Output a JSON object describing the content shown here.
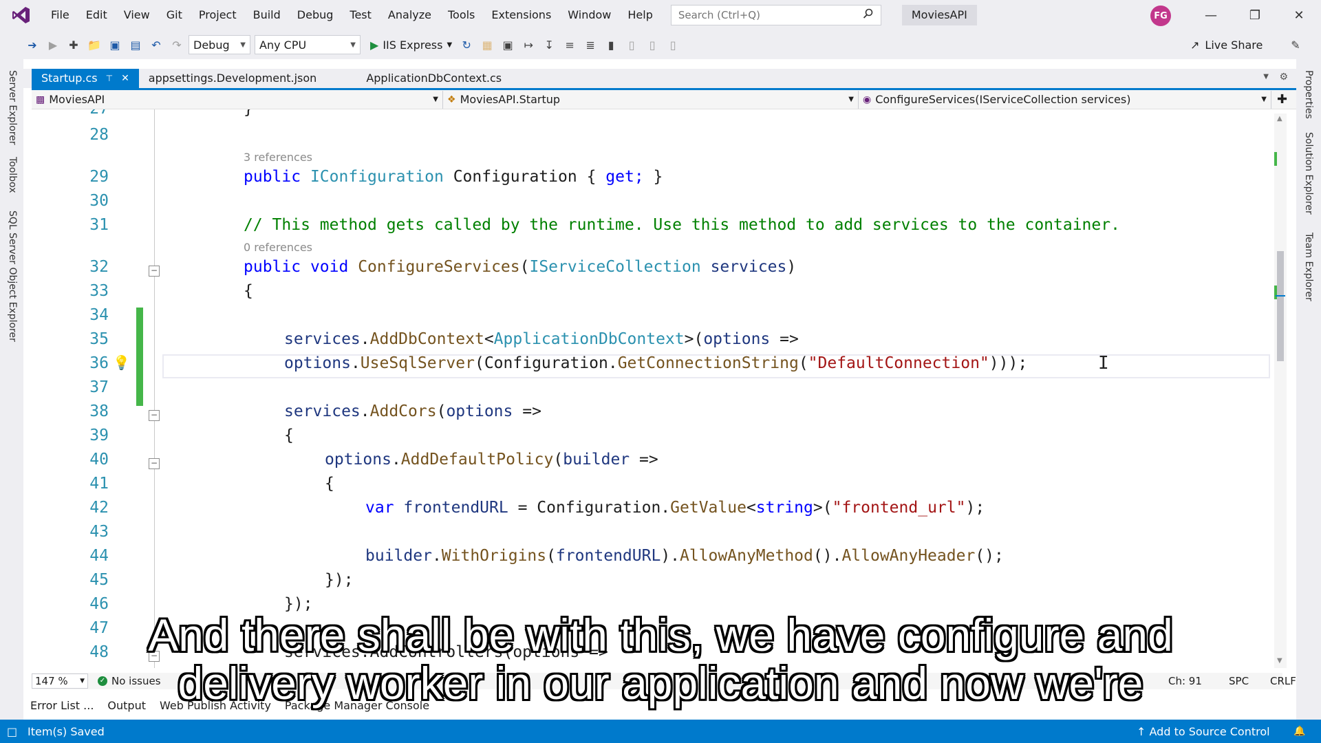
{
  "menubar": {
    "items": [
      "File",
      "Edit",
      "View",
      "Git",
      "Project",
      "Build",
      "Debug",
      "Test",
      "Analyze",
      "Tools",
      "Extensions",
      "Window",
      "Help"
    ],
    "search_placeholder": "Search (Ctrl+Q)",
    "solution_name": "MoviesAPI",
    "avatar_initials": "FG"
  },
  "toolbar": {
    "configuration": "Debug",
    "platform": "Any CPU",
    "run_target": "IIS Express",
    "live_share": "Live Share"
  },
  "left_rail": [
    "Server Explorer",
    "Toolbox",
    "SQL Server Object Explorer"
  ],
  "right_rail": [
    "Properties",
    "Solution Explorer",
    "Team Explorer"
  ],
  "tabs": {
    "active": "Startup.cs",
    "others": [
      "appsettings.Development.json",
      "ApplicationDbContext.cs"
    ]
  },
  "navbar": {
    "project": "MoviesAPI",
    "class": "MoviesAPI.Startup",
    "member": "ConfigureServices(IServiceCollection services)"
  },
  "editor": {
    "line_numbers": [
      "27",
      "28",
      "29",
      "30",
      "31",
      "32",
      "33",
      "34",
      "35",
      "36",
      "37",
      "38",
      "39",
      "40",
      "41",
      "42",
      "43",
      "44",
      "45",
      "46",
      "47",
      "48"
    ],
    "ref_3": "3 references",
    "ref_0": "0 references",
    "code": {
      "l27": "}",
      "l29_kw": "public",
      "l29_ty": "IConfiguration",
      "l29_name": "Configuration",
      "l29_open": "{",
      "l29_get": "get;",
      "l29_close": "}",
      "l31": "// This method gets called by the runtime. Use this method to add services to the container.",
      "l32_kw1": "public",
      "l32_kw2": "void",
      "l32_me": "ConfigureServices",
      "l32_ty": "IServiceCollection",
      "l32_pa": "services",
      "l33": "{",
      "l35_obj": "services",
      "l35_me": "AddDbContext",
      "l35_ty": "ApplicationDbContext",
      "l35_pa": "options",
      "l36_obj": "options",
      "l36_me": "UseSqlServer",
      "l36_cfg": "Configuration",
      "l36_me2": "GetConnectionString",
      "l36_str": "\"DefaultConnection\"",
      "l38_obj": "services",
      "l38_me": "AddCors",
      "l38_pa": "options",
      "l39": "{",
      "l40_obj": "options",
      "l40_me": "AddDefaultPolicy",
      "l40_pa": "builder",
      "l41": "{",
      "l42_kw": "var",
      "l42_var": "frontendURL",
      "l42_cfg": "Configuration",
      "l42_me": "GetValue",
      "l42_ty": "string",
      "l42_str": "\"frontend_url\"",
      "l44_obj": "builder",
      "l44_me1": "WithOrigins",
      "l44_var": "frontendURL",
      "l44_me2": "AllowAnyMethod",
      "l44_me3": "AllowAnyHeader",
      "l45": "});",
      "l46": "});",
      "l48": "services.AddControllers(options =>"
    }
  },
  "editor_status": {
    "zoom": "147 %",
    "issues": "No issues",
    "ch": "Ch: 91",
    "spc": "SPC",
    "crlf": "CRLF"
  },
  "tool_tabs": [
    "Error List ...",
    "Output",
    "Web Publish Activity",
    "Package Manager Console"
  ],
  "statusbar": {
    "saved": "Item(s) Saved",
    "source": "Add to Source Control"
  },
  "subtitle": {
    "line1": "And there shall be with this, we have configure and",
    "line2": "delivery worker in our application and now we're"
  }
}
